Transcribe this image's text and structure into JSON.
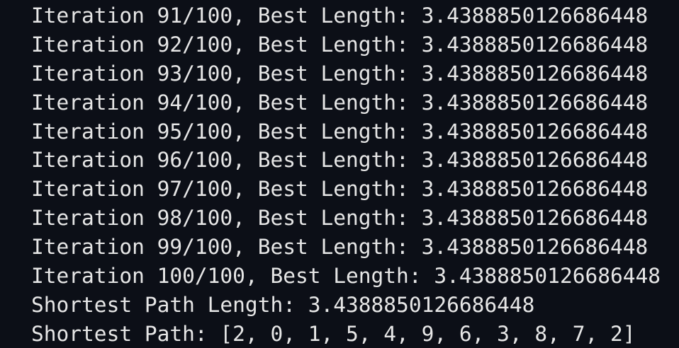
{
  "terminal": {
    "lines": [
      "Iteration 91/100, Best Length: 3.4388850126686448",
      "Iteration 92/100, Best Length: 3.4388850126686448",
      "Iteration 93/100, Best Length: 3.4388850126686448",
      "Iteration 94/100, Best Length: 3.4388850126686448",
      "Iteration 95/100, Best Length: 3.4388850126686448",
      "Iteration 96/100, Best Length: 3.4388850126686448",
      "Iteration 97/100, Best Length: 3.4388850126686448",
      "Iteration 98/100, Best Length: 3.4388850126686448",
      "Iteration 99/100, Best Length: 3.4388850126686448",
      "Iteration 100/100, Best Length: 3.4388850126686448",
      "Shortest Path Length: 3.4388850126686448",
      "Shortest Path: [2, 0, 1, 5, 4, 9, 6, 3, 8, 7, 2]"
    ],
    "colors": {
      "background": "#0c0f17",
      "text": "#e6e6e6"
    }
  }
}
